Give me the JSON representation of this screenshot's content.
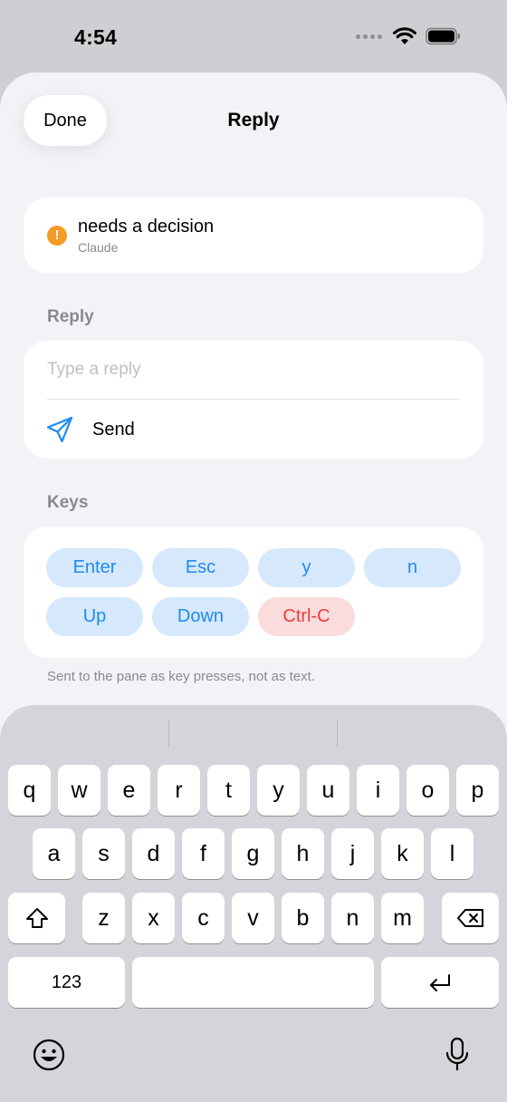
{
  "status_bar": {
    "time": "4:54"
  },
  "sheet": {
    "title": "Reply",
    "done_label": "Done"
  },
  "notice": {
    "icon": "exclamation-icon",
    "icon_glyph": "!",
    "title": "needs a decision",
    "source": "Claude",
    "accent": "#f59a23"
  },
  "reply": {
    "section_label": "Reply",
    "placeholder": "Type a reply",
    "value": "",
    "send_label": "Send",
    "send_icon": "paper-plane-icon",
    "accent": "#1e8bf1"
  },
  "keys": {
    "section_label": "Keys",
    "row1": [
      "Enter",
      "Esc",
      "y",
      "n"
    ],
    "row2": [
      "Up",
      "Down",
      "Ctrl-C"
    ],
    "footnote": "Sent to the pane as key presses, not as text.",
    "chip_bg": "#d6e8fb",
    "danger_bg": "#fbdcdc",
    "danger_color": "#ef3a3a"
  },
  "keyboard": {
    "row1": [
      "q",
      "w",
      "e",
      "r",
      "t",
      "y",
      "u",
      "i",
      "o",
      "p"
    ],
    "row2": [
      "a",
      "s",
      "d",
      "f",
      "g",
      "h",
      "j",
      "k",
      "l"
    ],
    "row3": [
      "z",
      "x",
      "c",
      "v",
      "b",
      "n",
      "m"
    ],
    "numbers_label": "123"
  }
}
